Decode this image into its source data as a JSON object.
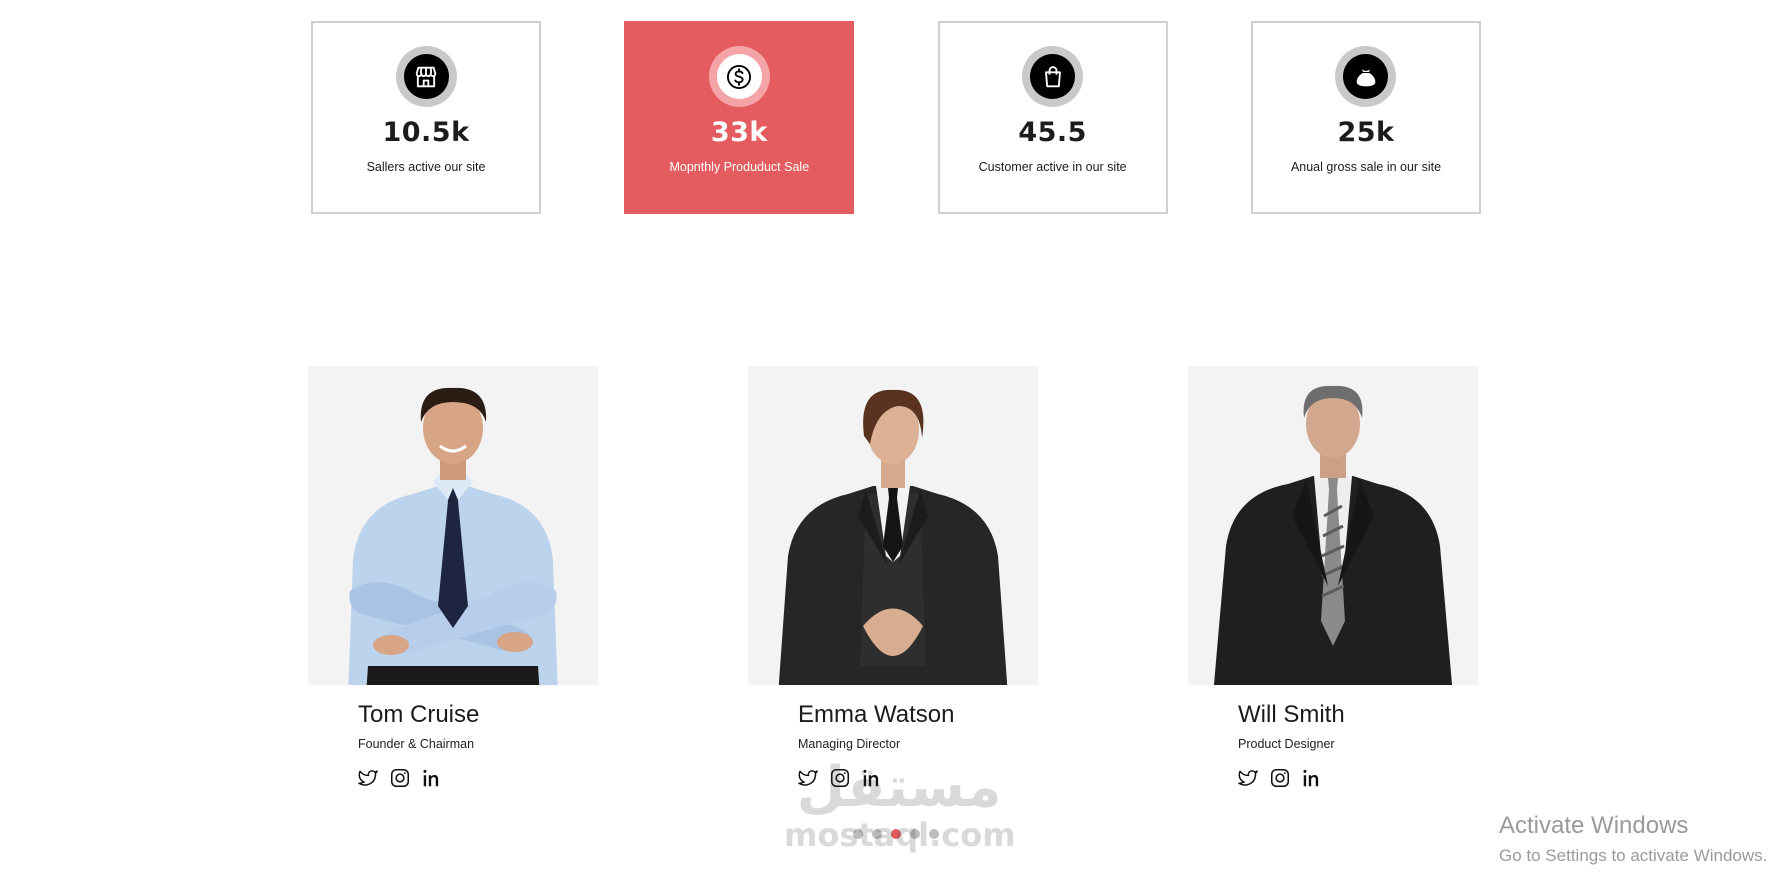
{
  "stats": [
    {
      "icon": "store-icon",
      "value": "10.5k",
      "label": "Sallers active our site",
      "active": false
    },
    {
      "icon": "dollar-coin-icon",
      "value": "33k",
      "label": "Mopnthly Produduct Sale",
      "active": true
    },
    {
      "icon": "shopping-bag-icon",
      "value": "45.5",
      "label": "Customer active in our site",
      "active": false
    },
    {
      "icon": "money-bag-icon",
      "value": "25k",
      "label": "Anual gross sale in our site",
      "active": false
    }
  ],
  "team": [
    {
      "name": "Tom Cruise",
      "role": "Founder & Chairman",
      "socials": [
        "twitter-icon",
        "instagram-icon",
        "linkedin-icon"
      ]
    },
    {
      "name": "Emma Watson",
      "role": "Managing Director",
      "socials": [
        "twitter-icon",
        "instagram-icon",
        "linkedin-icon"
      ]
    },
    {
      "name": "Will Smith",
      "role": "Product Designer",
      "socials": [
        "twitter-icon",
        "instagram-icon",
        "linkedin-icon"
      ]
    }
  ],
  "carousel": {
    "total": 5,
    "active_index": 2
  },
  "watermark": {
    "arabic": "مستقل",
    "latin": "mostaql.com"
  },
  "activation": {
    "title": "Activate Windows",
    "subtitle": "Go to Settings to activate Windows."
  },
  "colors": {
    "accent": "#e55c60",
    "card_border": "#cfcfcf",
    "photo_bg": "#f3f3f3"
  }
}
